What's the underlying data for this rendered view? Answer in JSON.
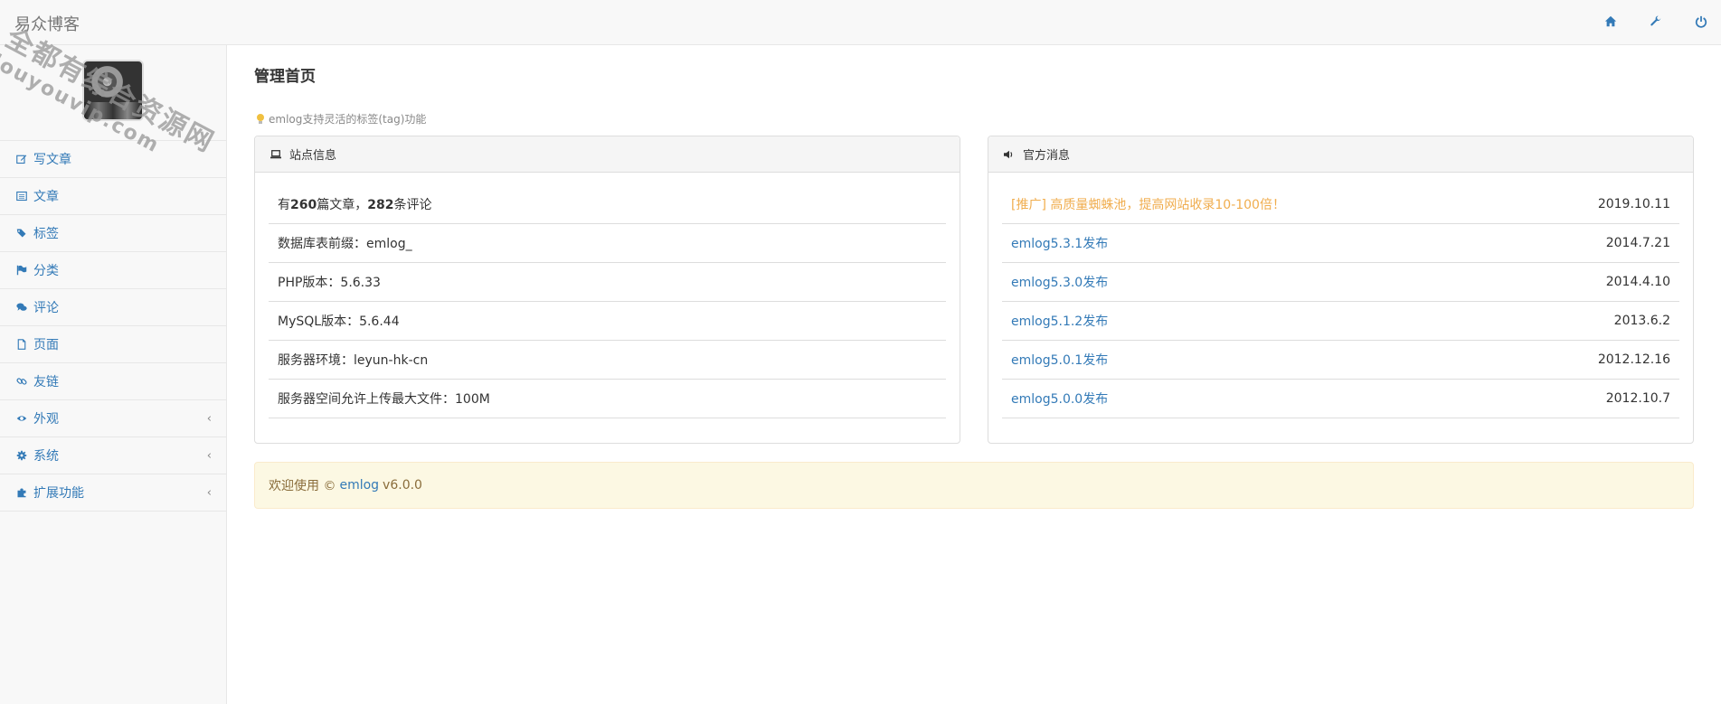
{
  "brand": "易众博客",
  "watermark": {
    "line1": "全都有综合资源网",
    "line2": "douyouvip.com"
  },
  "top_icons": [
    "home-icon",
    "wrench-icon",
    "power-icon"
  ],
  "nav": [
    {
      "label": "写文章",
      "icon": "edit-icon",
      "chevron": ""
    },
    {
      "label": "文章",
      "icon": "list-icon",
      "chevron": ""
    },
    {
      "label": "标签",
      "icon": "tags-icon",
      "chevron": ""
    },
    {
      "label": "分类",
      "icon": "flag-icon",
      "chevron": ""
    },
    {
      "label": "评论",
      "icon": "comments-icon",
      "chevron": ""
    },
    {
      "label": "页面",
      "icon": "file-icon",
      "chevron": ""
    },
    {
      "label": "友链",
      "icon": "link-icon",
      "chevron": ""
    },
    {
      "label": "外观",
      "icon": "eye-icon",
      "chevron": "‹"
    },
    {
      "label": "系统",
      "icon": "gear-icon",
      "chevron": "‹"
    },
    {
      "label": "扩展功能",
      "icon": "puzzle-icon",
      "chevron": "‹"
    }
  ],
  "main": {
    "title": "管理首页",
    "tip": "emlog支持灵活的标签(tag)功能"
  },
  "site_info": {
    "heading": "站点信息",
    "stats": {
      "prefix": "有",
      "articles": "260",
      "mid": "篇文章，",
      "comments": "282",
      "suffix": "条评论"
    },
    "rows": [
      "数据库表前缀：emlog_",
      "PHP版本：5.6.33",
      "MySQL版本：5.6.44",
      "服务器环境：leyun-hk-cn",
      "服务器空间允许上传最大文件：100M"
    ]
  },
  "news": {
    "heading": "官方消息",
    "items": [
      {
        "title": "[推广] 高质量蜘蛛池，提高网站收录10-100倍！",
        "date": "2019.10.11",
        "promo": true
      },
      {
        "title": "emlog5.3.1发布",
        "date": "2014.7.21",
        "promo": false
      },
      {
        "title": "emlog5.3.0发布",
        "date": "2014.4.10",
        "promo": false
      },
      {
        "title": "emlog5.1.2发布",
        "date": "2013.6.2",
        "promo": false
      },
      {
        "title": "emlog5.0.1发布",
        "date": "2012.12.16",
        "promo": false
      },
      {
        "title": "emlog5.0.0发布",
        "date": "2012.10.7",
        "promo": false
      }
    ]
  },
  "footer": {
    "welcome": "欢迎使用 ©",
    "link": "emlog",
    "version": "v6.0.0"
  },
  "colors": {
    "link": "#337ab7",
    "promo": "#f0ad4e",
    "footer_bg": "#fcf8e3",
    "footer_text": "#8a6d3b"
  }
}
